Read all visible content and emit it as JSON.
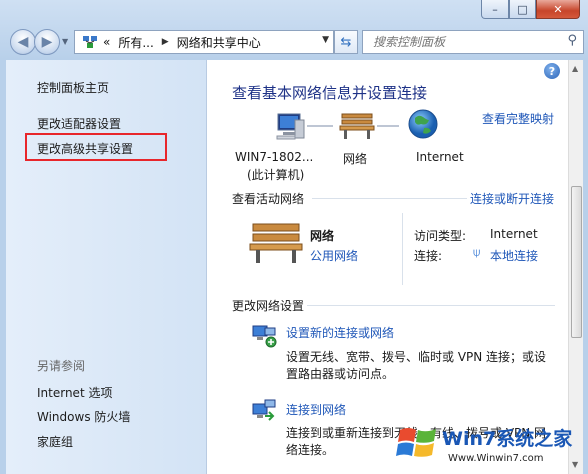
{
  "window": {
    "caption_buttons": {
      "minimize": "–",
      "maximize": "□",
      "close": "✕"
    }
  },
  "navigation": {
    "breadcrumb": [
      "所有...",
      "网络和共享中心"
    ],
    "breadcrumb_overflow": "«",
    "search_placeholder": "搜索控制面板"
  },
  "left_pane": {
    "links": [
      "控制面板主页",
      "更改适配器设置",
      "更改高级共享设置"
    ],
    "see_also_title": "另请参阅",
    "see_also_links": [
      "Internet 选项",
      "Windows 防火墙",
      "家庭组"
    ],
    "highlight_color": "#e8262b"
  },
  "main": {
    "title": "查看基本网络信息并设置连接",
    "view_full_map": "查看完整映射",
    "map": {
      "computer_name_line1": "WIN7-1802...",
      "computer_name_line2": "(此计算机)",
      "network_label": "网络",
      "internet_label": "Internet"
    },
    "active_networks": {
      "heading": "查看活动网络",
      "connect_disconnect": "连接或断开连接",
      "network_name": "网络",
      "network_type": "公用网络",
      "access_type_label": "访问类型:",
      "access_type_value": "Internet",
      "connections_label": "连接:",
      "connections_value": "本地连接"
    },
    "change_settings": {
      "heading": "更改网络设置",
      "items": [
        {
          "link": "设置新的连接或网络",
          "desc1": "设置无线、宽带、拨号、临时或 VPN 连接；或设",
          "desc2": "置路由器或访问点。"
        },
        {
          "link": "连接到网络",
          "desc1": "连接到或重新连接到无线、有线、拨号或 VPN 网",
          "desc2": "络连接。"
        }
      ]
    }
  },
  "watermark": {
    "brand": "Win7系统之家",
    "url": "Www.Winwin7.com"
  },
  "colors": {
    "link": "#1f57b8",
    "title": "#1e3287",
    "left_pane": "#dbe8f7"
  }
}
